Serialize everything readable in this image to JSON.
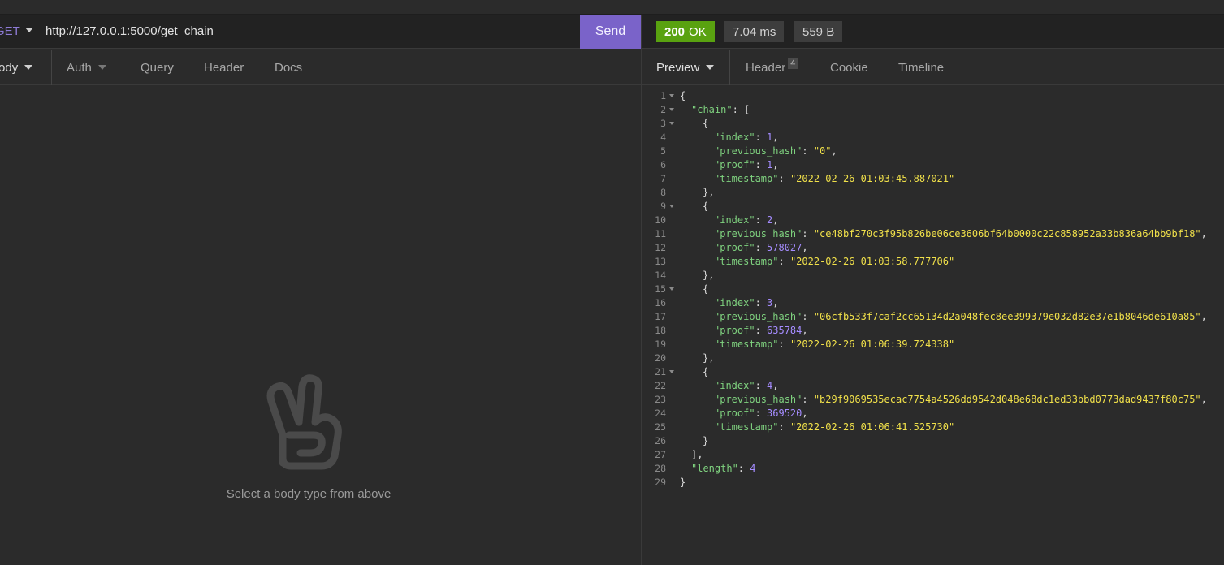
{
  "request": {
    "method": "GET",
    "url": "http://127.0.0.1:5000/get_chain",
    "send_label": "Send",
    "tabs": [
      {
        "label": "Body"
      },
      {
        "label": "Auth"
      },
      {
        "label": "Query"
      },
      {
        "label": "Header"
      },
      {
        "label": "Docs"
      }
    ],
    "empty_message": "Select a body type from above"
  },
  "response": {
    "status_code": "200",
    "status_text": "OK",
    "time": "7.04 ms",
    "size": "559 B",
    "tabs": [
      {
        "label": "Preview"
      },
      {
        "label": "Header",
        "count": "4"
      },
      {
        "label": "Cookie"
      },
      {
        "label": "Timeline"
      }
    ],
    "body": {
      "chain": [
        {
          "index": 1,
          "previous_hash": "0",
          "proof": 1,
          "timestamp": "2022-02-26 01:03:45.887021"
        },
        {
          "index": 2,
          "previous_hash": "ce48bf270c3f95b826be06ce3606bf64b0000c22c858952a33b836a64bb9bf18",
          "proof": 578027,
          "timestamp": "2022-02-26 01:03:58.777706"
        },
        {
          "index": 3,
          "previous_hash": "06cfb533f7caf2cc65134d2a048fec8ee399379e032d82e37e1b8046de610a85",
          "proof": 635784,
          "timestamp": "2022-02-26 01:06:39.724338"
        },
        {
          "index": 4,
          "previous_hash": "b29f9069535ecac7754a4526dd9542d048e68dc1ed33bbd0773dad9437f80c75",
          "proof": 369520,
          "timestamp": "2022-02-26 01:06:41.525730"
        }
      ],
      "length": 4
    }
  },
  "colors": {
    "accent": "#7a63c9",
    "status_ok": "#59a210",
    "json_key": "#7fd27f",
    "json_string": "#f0e04a",
    "json_number": "#a58cff"
  },
  "icons": {
    "empty_state": "peace-hand-icon"
  }
}
